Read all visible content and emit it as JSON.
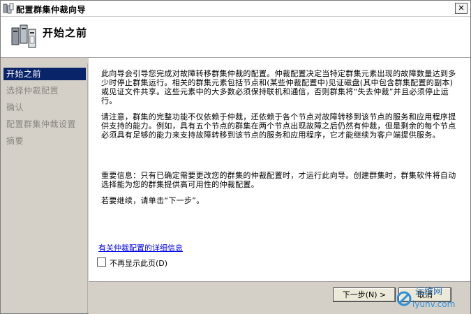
{
  "window": {
    "title": "配置群集仲裁向导"
  },
  "header": {
    "title": "开始之前"
  },
  "sidebar": {
    "items": [
      {
        "label": "开始之前"
      },
      {
        "label": "选择仲裁配置"
      },
      {
        "label": "确认"
      },
      {
        "label": "配置群集仲裁设置"
      },
      {
        "label": "摘要"
      }
    ]
  },
  "content": {
    "paragraphs": [
      "此向导会引导您完成对故障转移群集仲裁的配置。仲裁配置决定当特定群集元素出现的故障数量达到多少时停止群集运行。相关的群集元素包括节点和(某些仲裁配置中)见证磁盘(其中包含群集配置的副本)或见证文件共享。这些元素中的大多数必须保持联机和通信，否则群集将“失去仲裁”并且必须停止运行。",
      "请注意，群集的完整功能不仅依赖于仲裁，还依赖于各个节点对故障转移到该节点的服务和应用程序提供支持的能力。例如，具有五个节点的群集在两个节点出现故障之后仍然有仲裁，但是剩余的每个节点必须具有足够的能力来支持故障转移到该节点的服务和应用程序，它才能继续为客户端提供服务。",
      "重要信息：只有已确定需要更改您的群集的仲裁配置时，才运行此向导。创建群集时，群集软件将自动选择能为您的群集提供高可用性的仲裁配置。",
      "若要继续，请单击“下一步”。"
    ],
    "link": "有关仲裁配置的详细信息",
    "checkbox_label": "不再显示此页(D)"
  },
  "footer": {
    "next_label": "下一步(N) >",
    "cancel_label": "取消"
  },
  "watermark": {
    "text": "运维网",
    "domain": "iyunv.com"
  }
}
